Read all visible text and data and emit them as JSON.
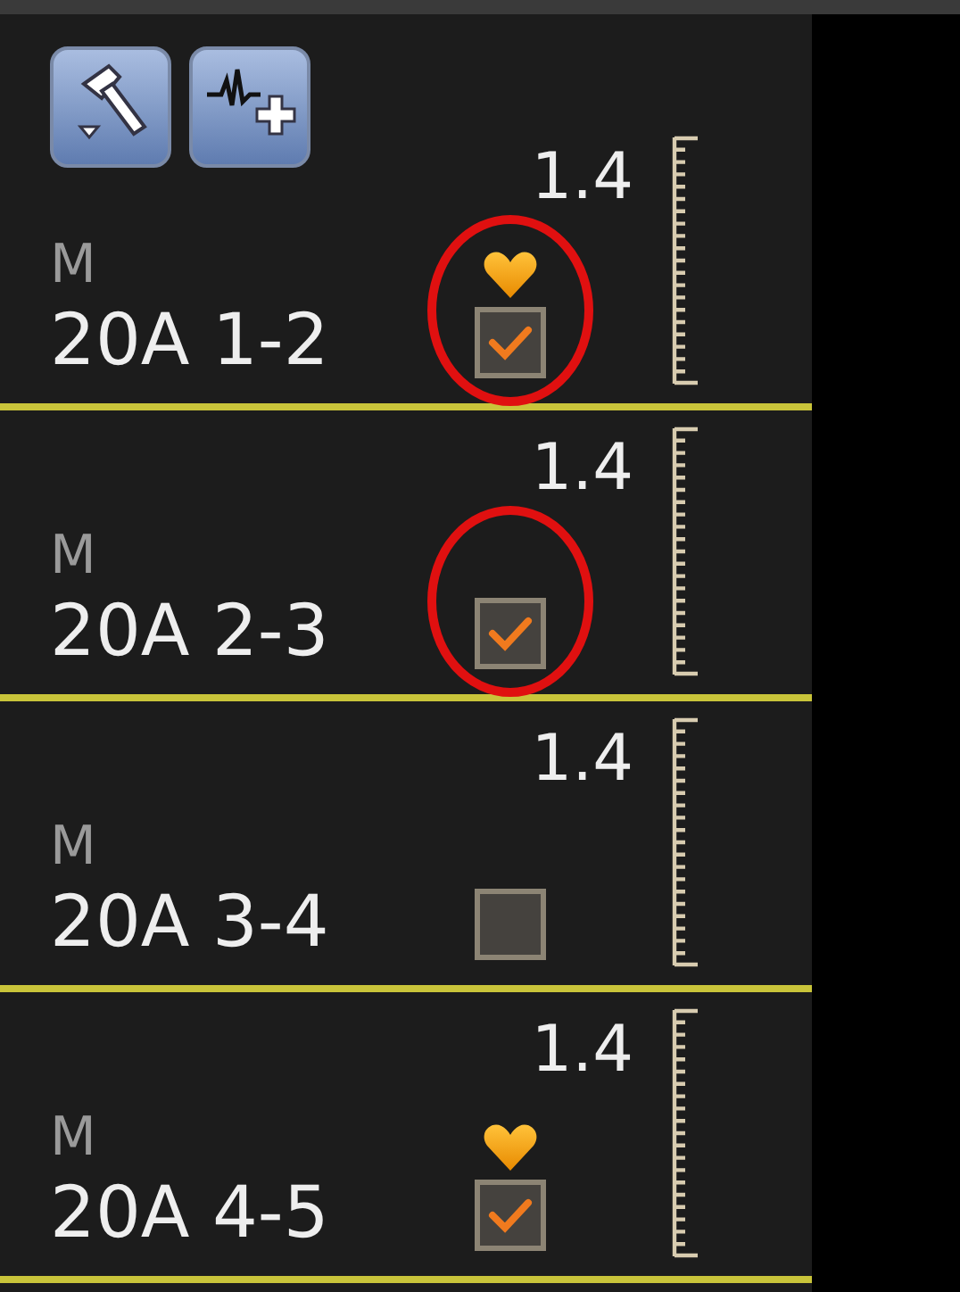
{
  "toolbar": {
    "buttons": [
      {
        "kind": "hammer"
      },
      {
        "kind": "waveform-add"
      }
    ]
  },
  "channels": [
    {
      "mode": "M",
      "name": "20A 1-2",
      "value": "1.4",
      "favorite": true,
      "checked": true,
      "highlighted": true
    },
    {
      "mode": "M",
      "name": "20A 2-3",
      "value": "1.4",
      "favorite": false,
      "checked": true,
      "highlighted": true
    },
    {
      "mode": "M",
      "name": "20A 3-4",
      "value": "1.4",
      "favorite": false,
      "checked": false,
      "highlighted": false
    },
    {
      "mode": "M",
      "name": "20A 4-5",
      "value": "1.4",
      "favorite": true,
      "checked": true,
      "highlighted": false
    }
  ]
}
